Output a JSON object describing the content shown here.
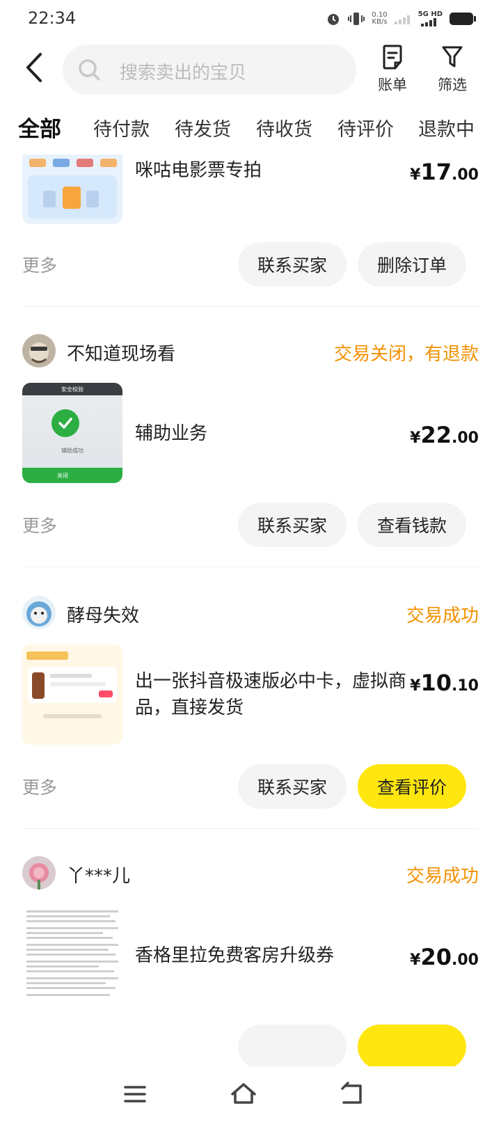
{
  "status_bar": {
    "time": "22:34",
    "net_speed_value": "0.10",
    "net_speed_unit": "KB/s",
    "network_label": "5G HD"
  },
  "header": {
    "search_placeholder": "搜索卖出的宝贝",
    "bill_label": "账单",
    "filter_label": "筛选"
  },
  "tabs": [
    {
      "label": "全部",
      "active": true
    },
    {
      "label": "待付款"
    },
    {
      "label": "待发货"
    },
    {
      "label": "待收货"
    },
    {
      "label": "待评价"
    },
    {
      "label": "退款中"
    }
  ],
  "orders": [
    {
      "title": "咪咕电影票专拍",
      "price_int": "17",
      "price_dec": ".00",
      "more": "更多",
      "buttons": [
        "联系买家",
        "删除订单"
      ]
    },
    {
      "buyer": "不知道现场看",
      "status": "交易关闭，有退款",
      "title": "辅助业务",
      "price_int": "22",
      "price_dec": ".00",
      "thumb_texts": [
        "安全校验",
        "辅助成功",
        "关闭"
      ],
      "more": "更多",
      "buttons": [
        "联系买家",
        "查看钱款"
      ]
    },
    {
      "buyer": "酵母失效",
      "status": "交易成功",
      "title": "出一张抖音极速版必中卡，虚拟商品，直接发货",
      "price_int": "10",
      "price_dec": ".10",
      "more": "更多",
      "buttons": [
        "联系买家",
        "查看评价"
      ]
    },
    {
      "buyer": "丫***儿",
      "status": "交易成功",
      "title": "香格里拉免费客房升级券",
      "price_int": "20",
      "price_dec": ".00"
    }
  ],
  "currency_symbol": "¥",
  "colors": {
    "accent_yellow": "#ffe60f",
    "status_orange": "#f29100",
    "button_gray": "#f4f4f4"
  }
}
